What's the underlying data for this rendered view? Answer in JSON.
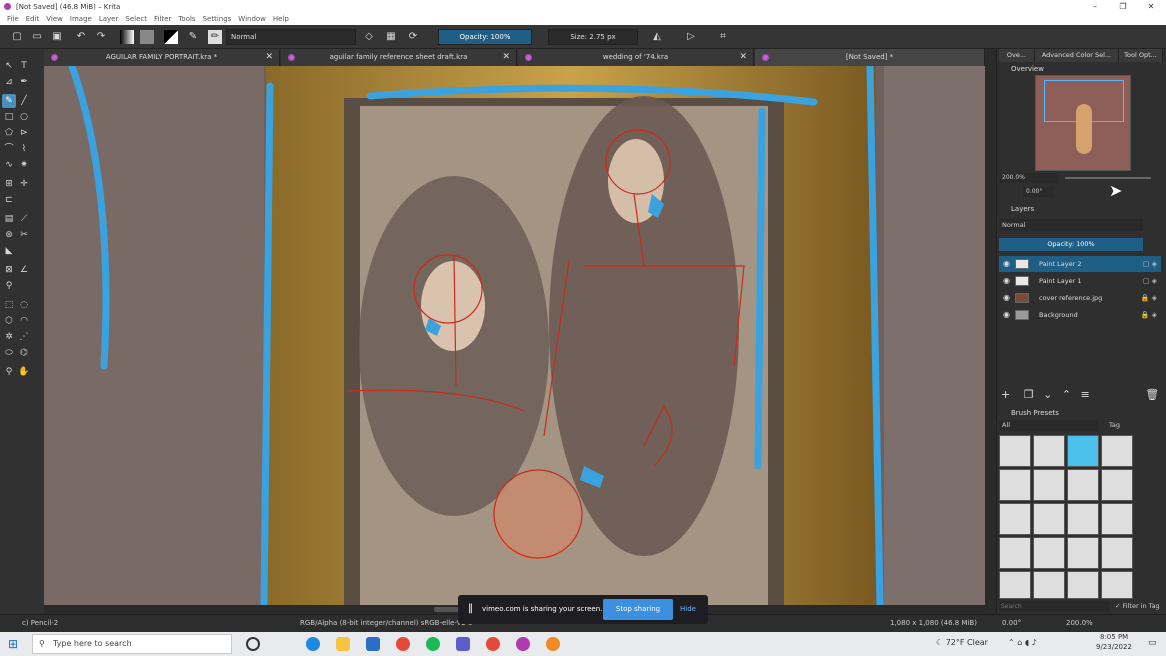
{
  "window": {
    "title": "[Not Saved]  (46.8 MiB)  – Krita",
    "controls": [
      "–",
      "❐",
      "✕"
    ]
  },
  "menu": [
    "File",
    "Edit",
    "View",
    "Image",
    "Layer",
    "Select",
    "Filter",
    "Tools",
    "Settings",
    "Window",
    "Help"
  ],
  "toolbar": {
    "blend_mode": "Normal",
    "opacity": "Opacity: 100%",
    "size": "Size: 2.75 px"
  },
  "tabs": [
    {
      "label": "AGUILAR FAMILY PORTRAIT.kra *"
    },
    {
      "label": "aguilar family reference sheet draft.kra"
    },
    {
      "label": "wedding of '74.kra"
    },
    {
      "label": "[Not Saved]  *"
    }
  ],
  "dock": {
    "top_tabs": [
      "Ove...",
      "Advanced Color Sel...",
      "Tool Opt..."
    ],
    "overview_title": "Overview",
    "zoom": "200.0%",
    "rotation": "0.00°",
    "layers_title": "Layers",
    "layers_blend": "Normal",
    "layers_opacity": "Opacity:  100%",
    "layers": [
      {
        "name": "Paint Layer 2",
        "selected": true
      },
      {
        "name": "Paint Layer 1",
        "selected": false
      },
      {
        "name": "cover reference.jpg",
        "selected": false
      },
      {
        "name": "Background",
        "selected": false
      }
    ],
    "brush_title": "Brush Presets",
    "brush_filter": "All",
    "brush_tag": "Tag",
    "brush_search_placeholder": "Search",
    "filter_in_tag": "Filter in Tag"
  },
  "status": {
    "brush": "c) Pencil-2",
    "colorspace": "RGB/Alpha (8-bit integer/channel)  sRGB-elle-V2-s",
    "dimensions": "1,080 x 1,080 (46.8 MiB)",
    "rotation": "0.00°",
    "zoom": "200.0%"
  },
  "share_bar": {
    "message": "vimeo.com is sharing your screen.",
    "stop": "Stop sharing",
    "hide": "Hide"
  },
  "taskbar": {
    "search_placeholder": "Type here to search",
    "weather": "72°F  Clear",
    "time": "8:05 PM",
    "date": "9/23/2022"
  }
}
